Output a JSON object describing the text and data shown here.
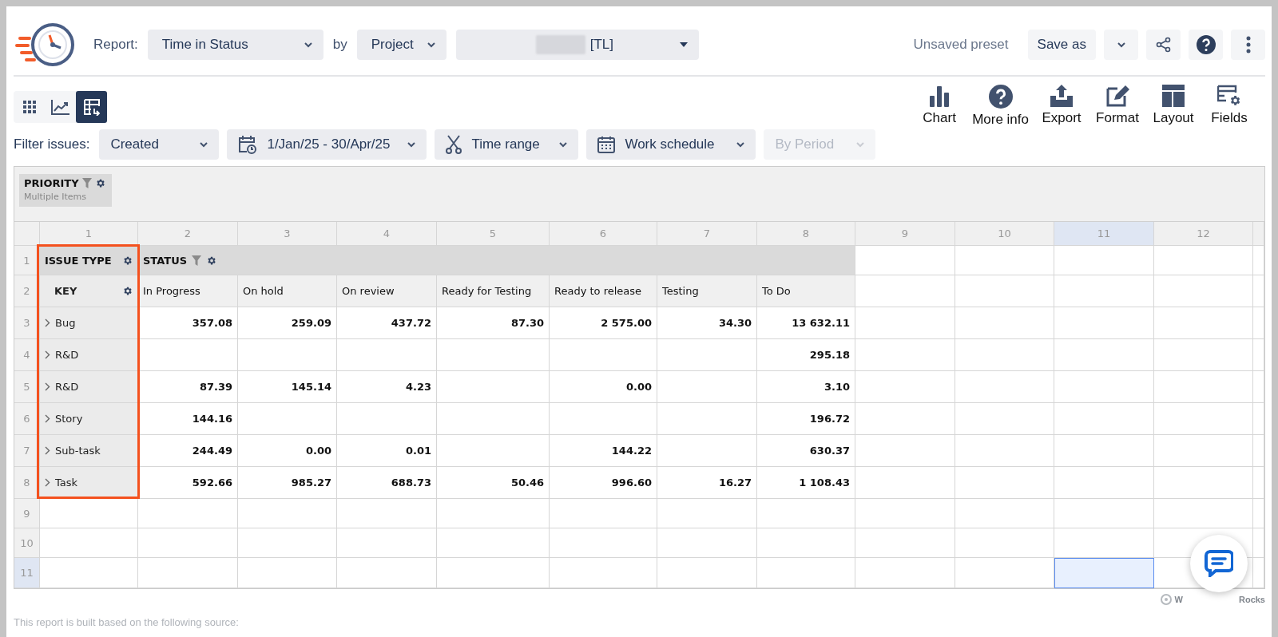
{
  "header": {
    "report_label": "Report:",
    "report_select": "Time in Status",
    "by_label": "by",
    "group_select": "Project",
    "project_select": "[TL]",
    "preset_status": "Unsaved preset",
    "save_button": "Save as"
  },
  "view_modes": [
    {
      "kind": "grid",
      "selected": false
    },
    {
      "kind": "chart",
      "selected": false
    },
    {
      "kind": "pivot",
      "selected": true
    }
  ],
  "toolbar": [
    {
      "kind": "chart",
      "label": "Chart"
    },
    {
      "kind": "info",
      "label": "More info"
    },
    {
      "kind": "export",
      "label": "Export"
    },
    {
      "kind": "format",
      "label": "Format"
    },
    {
      "kind": "layout",
      "label": "Layout"
    },
    {
      "kind": "fields",
      "label": "Fields"
    }
  ],
  "filters": {
    "label": "Filter issues:",
    "items": [
      {
        "kind": "select",
        "label": "Created",
        "disabled": false
      },
      {
        "kind": "date",
        "label": "1/Jan/25 - 30/Apr/25",
        "disabled": false
      },
      {
        "kind": "time",
        "label": "Time range",
        "disabled": false
      },
      {
        "kind": "schedule",
        "label": "Work schedule",
        "disabled": false
      },
      {
        "kind": "select",
        "label": "By Period",
        "disabled": true
      }
    ]
  },
  "pivot": {
    "filter_field": {
      "name": "PRIORITY",
      "value": "Multiple Items"
    },
    "column_headers": [
      {
        "label": "1",
        "selected": false
      },
      {
        "label": "2",
        "selected": false
      },
      {
        "label": "3",
        "selected": false
      },
      {
        "label": "4",
        "selected": false
      },
      {
        "label": "5",
        "selected": false
      },
      {
        "label": "6",
        "selected": false
      },
      {
        "label": "7",
        "selected": false
      },
      {
        "label": "8",
        "selected": false
      },
      {
        "label": "9",
        "selected": false
      },
      {
        "label": "10",
        "selected": false
      },
      {
        "label": "11",
        "selected": true
      },
      {
        "label": "12",
        "selected": false
      }
    ],
    "row_headers": [
      {
        "label": "1",
        "selected": false
      },
      {
        "label": "2",
        "selected": false
      },
      {
        "label": "3",
        "selected": false
      },
      {
        "label": "4",
        "selected": false
      },
      {
        "label": "5",
        "selected": false
      },
      {
        "label": "6",
        "selected": false
      },
      {
        "label": "7",
        "selected": false
      },
      {
        "label": "8",
        "selected": false
      },
      {
        "label": "9",
        "selected": false
      },
      {
        "label": "10",
        "selected": false
      },
      {
        "label": "11",
        "selected": true
      }
    ],
    "row_fields": [
      "ISSUE TYPE",
      "KEY"
    ],
    "row_fields_outlined": true,
    "column_field": "STATUS",
    "statuses": [
      "In Progress",
      "On hold",
      "On review",
      "Ready for Testing",
      "Ready to release",
      "Testing",
      "To Do"
    ],
    "rows": [
      {
        "label": "Bug",
        "cells": [
          "357.08",
          "259.09",
          "437.72",
          "87.30",
          "2 575.00",
          "34.30",
          "13 632.11"
        ]
      },
      {
        "label": "R&D",
        "cells": [
          null,
          null,
          null,
          null,
          null,
          null,
          "295.18"
        ]
      },
      {
        "label": "R&D",
        "cells": [
          "87.39",
          "145.14",
          "4.23",
          null,
          "0.00",
          null,
          "3.10"
        ]
      },
      {
        "label": "Story",
        "cells": [
          "144.16",
          null,
          null,
          null,
          null,
          null,
          "196.72"
        ]
      },
      {
        "label": "Sub-task",
        "cells": [
          "244.49",
          "0.00",
          "0.01",
          null,
          "144.22",
          null,
          "630.37"
        ]
      },
      {
        "label": "Task",
        "cells": [
          "592.66",
          "985.27",
          "688.73",
          "50.46",
          "996.60",
          "16.27",
          "1 108.43"
        ]
      }
    ]
  },
  "footer": {
    "brand_start": "W",
    "brand_end": "Rocks",
    "source_note": "This report is built based on the following source:"
  }
}
